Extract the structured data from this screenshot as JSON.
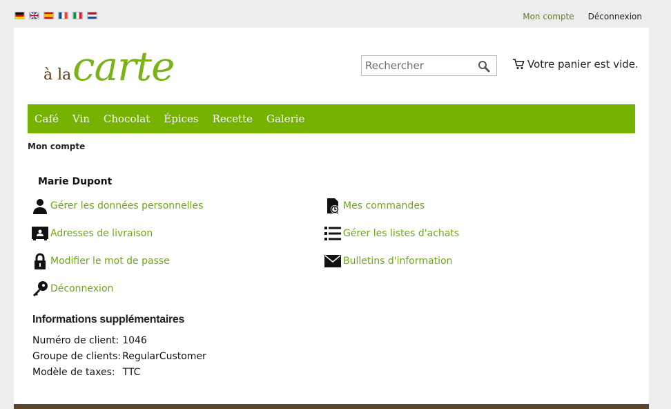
{
  "languages": [
    "de-flag-icon",
    "gb-flag-icon",
    "es-flag-icon",
    "fr-flag-icon",
    "it-flag-icon",
    "nl-flag-icon"
  ],
  "top_links": {
    "account": "Mon compte",
    "logout": "Déconnexion"
  },
  "logo": {
    "prefix": "à la",
    "main": "carte"
  },
  "search": {
    "placeholder": "Rechercher"
  },
  "cart": {
    "label": "Votre panier est vide."
  },
  "nav": [
    "Café",
    "Vin",
    "Chocolat",
    "Épices",
    "Recette",
    "Galerie"
  ],
  "breadcrumb": "Mon compte",
  "customer": {
    "name": "Marie Dupont"
  },
  "account_links": {
    "personal": "Gérer les données personnelles",
    "orders": "Mes commandes",
    "addresses": "Adresses de livraison",
    "wishlists": "Gérer les listes d'achats",
    "password": "Modifier le mot de passe",
    "newsletters": "Bulletins d'information",
    "logout": "Déconnexion"
  },
  "extra_info": {
    "title": "Informations supplémentaires",
    "customer_number_label": "Numéro de client:",
    "customer_number": "1046",
    "group_label": "Groupe de clients:",
    "group": "RegularCustomer",
    "tax_label": "Modèle de taxes:",
    "tax": "TTC"
  },
  "colors": {
    "accent": "#76b300",
    "link": "#6fa61a",
    "brown": "#5b4630"
  }
}
